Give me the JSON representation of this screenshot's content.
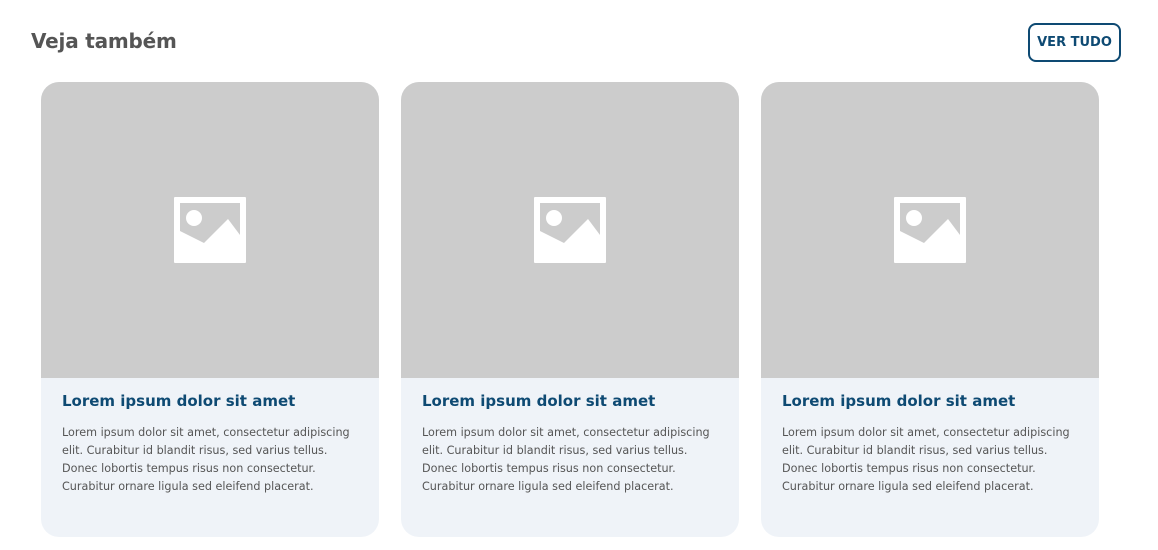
{
  "section": {
    "title": "Veja também",
    "view_all_label": "VER TUDO"
  },
  "cards": [
    {
      "image_icon": "image-placeholder-icon",
      "title": "Lorem ipsum dolor sit amet",
      "text": "Lorem ipsum dolor sit amet, consectetur adipiscing elit. Curabitur id blandit risus, sed varius tellus. Donec lobortis tempus risus non consectetur. Curabitur ornare ligula sed eleifend placerat."
    },
    {
      "image_icon": "image-placeholder-icon",
      "title": "Lorem ipsum dolor sit amet",
      "text": "Lorem ipsum dolor sit amet, consectetur adipiscing elit. Curabitur id blandit risus, sed varius tellus. Donec lobortis tempus risus non consectetur. Curabitur ornare ligula sed eleifend placerat."
    },
    {
      "image_icon": "image-placeholder-icon",
      "title": "Lorem ipsum dolor sit amet",
      "text": "Lorem ipsum dolor sit amet, consectetur adipiscing elit. Curabitur id blandit risus, sed varius tellus. Donec lobortis tempus risus non consectetur. Curabitur ornare ligula sed eleifend placerat."
    }
  ],
  "colors": {
    "accent": "#0e4a73",
    "title_gray": "#555555",
    "placeholder_bg": "#cccccc",
    "card_bg": "#eff3f8"
  }
}
